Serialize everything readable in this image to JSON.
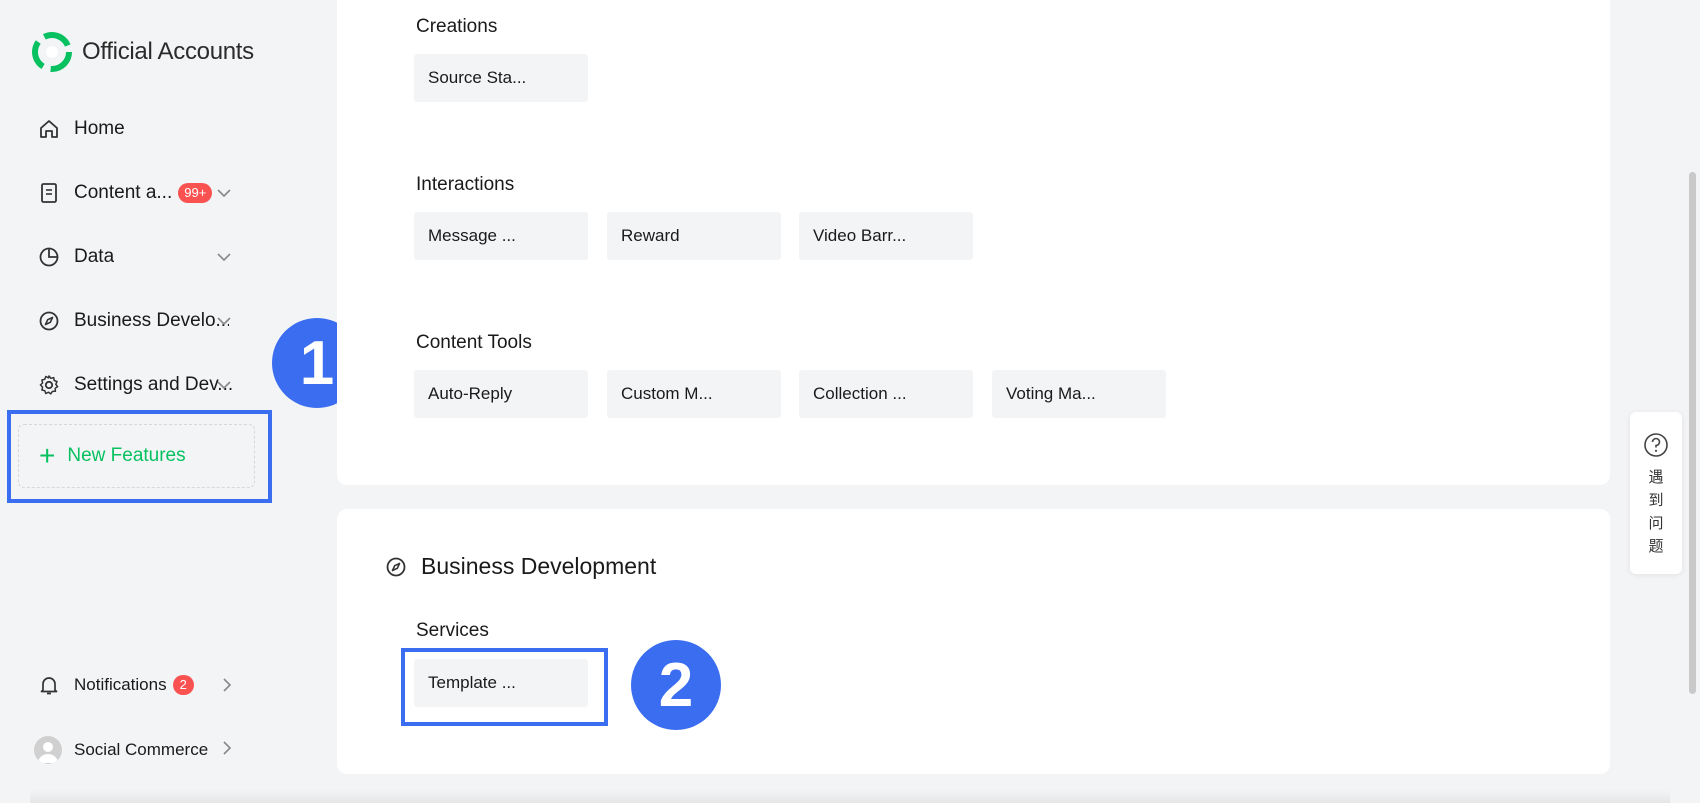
{
  "app": {
    "title": "Official Accounts"
  },
  "sidebar": {
    "items": [
      {
        "label": "Home",
        "icon": "home-icon"
      },
      {
        "label": "Content a...",
        "badge": "99+",
        "icon": "document-icon"
      },
      {
        "label": "Data",
        "icon": "pie-chart-icon"
      },
      {
        "label": "Business Develo...",
        "icon": "compass-icon"
      },
      {
        "label": "Settings and Dev...",
        "icon": "gear-icon"
      }
    ],
    "new_features": "New Features",
    "notifications": {
      "label": "Notifications",
      "badge": "2"
    },
    "social_commerce": {
      "label": "Social Commerce"
    }
  },
  "annotations": {
    "step1": "1",
    "step2": "2"
  },
  "main": {
    "creations": {
      "title": "Creations",
      "tiles": [
        "Source Sta..."
      ]
    },
    "interactions": {
      "title": "Interactions",
      "tiles": [
        "Message ...",
        "Reward",
        "Video Barr..."
      ]
    },
    "content_tools": {
      "title": "Content Tools",
      "tiles": [
        "Auto-Reply",
        "Custom M...",
        "Collection ...",
        "Voting Ma..."
      ]
    },
    "business_development": {
      "header": "Business Development",
      "services": {
        "title": "Services",
        "tiles": [
          "Template ..."
        ]
      }
    }
  },
  "help": {
    "text": "遇到问题"
  },
  "colors": {
    "accent": "#07c160",
    "annotation": "#3b6df0",
    "badge": "#fa5151"
  }
}
